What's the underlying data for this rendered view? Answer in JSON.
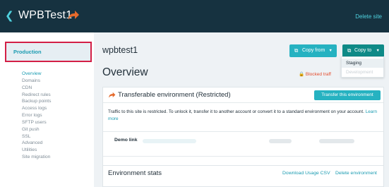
{
  "header": {
    "site_title": "WPBTest1",
    "delete_site": "Delete site"
  },
  "sidebar": {
    "environment": "Production",
    "items": [
      {
        "label": "Overview",
        "active": true
      },
      {
        "label": "Domains"
      },
      {
        "label": "CDN"
      },
      {
        "label": "Redirect rules"
      },
      {
        "label": "Backup points"
      },
      {
        "label": "Access logs"
      },
      {
        "label": "Error logs"
      },
      {
        "label": "SFTP users"
      },
      {
        "label": "Git push"
      },
      {
        "label": "SSL"
      },
      {
        "label": "Advanced"
      },
      {
        "label": "Utilities"
      },
      {
        "label": "Site migration"
      }
    ]
  },
  "main": {
    "env_name": "wpbtest1",
    "copy_from": "Copy from",
    "copy_to": "Copy to",
    "dropdown": {
      "staging": "Staging",
      "development": "Development"
    },
    "overview_title": "Overview",
    "blocked_badge": "Blocked traff",
    "transfer_card": {
      "title": "Transferable environment (Restricted)",
      "transfer_button": "Transfer this environment",
      "notice": "Traffic to this site is restricted. To unlock it, transfer it to another account or convert it to a standard environment on your account.",
      "learn_more": "Learn more",
      "demo_link_label": "Demo link"
    },
    "stats_card": {
      "title": "Environment stats",
      "download_csv": "Download Usage CSV",
      "delete_environment": "Delete environment"
    }
  },
  "colors": {
    "header_bg": "#163240",
    "accent": "#26b2c1",
    "accent_dark": "#0e8a87",
    "highlight_border": "#d31f46",
    "warning": "#e44d2e"
  }
}
